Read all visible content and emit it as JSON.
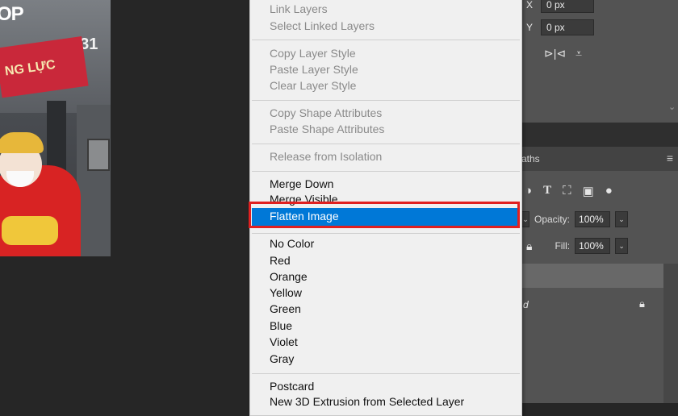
{
  "canvas": {
    "photo_sign_text": "OP",
    "photo_number": "131",
    "photo_banner_text": "NG LỰC"
  },
  "properties": {
    "x_label": "X",
    "x_value": "0 px",
    "y_label": "Y",
    "y_value": "0 px"
  },
  "layers_panel": {
    "tab_label": "aths",
    "opacity_label": "Opacity:",
    "opacity_value": "100%",
    "fill_label": "Fill:",
    "fill_value": "100%",
    "layer_name_fragment": "d"
  },
  "context_menu": {
    "groups": [
      [
        {
          "label": "Link Layers",
          "enabled": false
        },
        {
          "label": "Select Linked Layers",
          "enabled": false
        }
      ],
      [
        {
          "label": "Copy Layer Style",
          "enabled": false
        },
        {
          "label": "Paste Layer Style",
          "enabled": false
        },
        {
          "label": "Clear Layer Style",
          "enabled": false
        }
      ],
      [
        {
          "label": "Copy Shape Attributes",
          "enabled": false
        },
        {
          "label": "Paste Shape Attributes",
          "enabled": false
        }
      ],
      [
        {
          "label": "Release from Isolation",
          "enabled": false
        }
      ],
      [
        {
          "label": "Merge Down",
          "enabled": true
        },
        {
          "label": "Merge Visible",
          "enabled": true
        },
        {
          "label": "Flatten Image",
          "enabled": true,
          "selected": true
        }
      ],
      [
        {
          "label": "No Color",
          "enabled": true
        },
        {
          "label": "Red",
          "enabled": true
        },
        {
          "label": "Orange",
          "enabled": true
        },
        {
          "label": "Yellow",
          "enabled": true
        },
        {
          "label": "Green",
          "enabled": true
        },
        {
          "label": "Blue",
          "enabled": true
        },
        {
          "label": "Violet",
          "enabled": true
        },
        {
          "label": "Gray",
          "enabled": true
        }
      ],
      [
        {
          "label": "Postcard",
          "enabled": true
        },
        {
          "label": "New 3D Extrusion from Selected Layer",
          "enabled": true
        }
      ]
    ]
  },
  "colors": {
    "highlight": "#0078d7",
    "annotation_box": "#e02020"
  }
}
